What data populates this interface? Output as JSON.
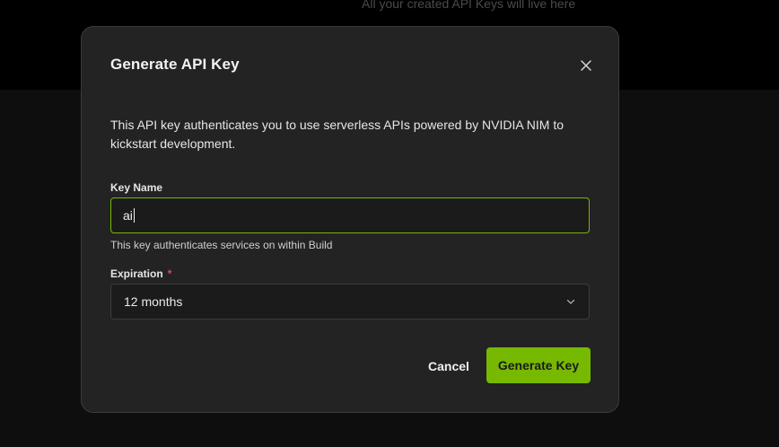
{
  "background": {
    "caption": "All your created API Keys will live here"
  },
  "modal": {
    "title": "Generate API Key",
    "close_icon": "close-icon",
    "description": "This API key authenticates you to use serverless APIs powered by NVIDIA NIM to kickstart development.",
    "key_name": {
      "label": "Key Name",
      "value": "ai",
      "helper": "This key authenticates services on within Build"
    },
    "expiration": {
      "label": "Expiration",
      "required_mark": "*",
      "selected": "12 months",
      "chevron_icon": "chevron-down-icon"
    },
    "actions": {
      "cancel_label": "Cancel",
      "generate_label": "Generate Key"
    }
  },
  "colors": {
    "accent": "#76b900",
    "modal_bg": "#232323",
    "required": "#e5484d"
  }
}
